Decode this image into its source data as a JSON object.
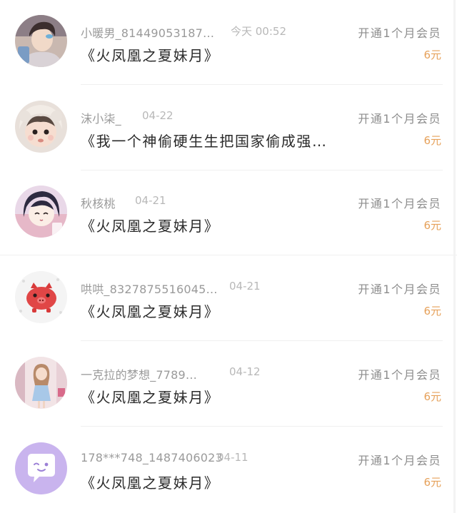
{
  "colors": {
    "name": "#9a9a9a",
    "time": "#b8b8b8",
    "title": "#2a2a2a",
    "action": "#8c8c8c",
    "price": "#e6a15a"
  },
  "rows": [
    {
      "avatar": "boy-photo-avatar",
      "name": "小暖男_81449053187…",
      "time": "今天 00:52",
      "title": "《火凤凰之夏妹月》",
      "action": "开通1个月会员",
      "price": "6元"
    },
    {
      "avatar": "baby-photo-avatar",
      "name": "沫小柒_",
      "time": "04-22",
      "title": "《我一个神偷硬生生把国家偷成强…",
      "action": "开通1个月会员",
      "price": "6元"
    },
    {
      "avatar": "anime-girl-avatar",
      "name": "秋核桃",
      "time": "04-21",
      "title": "《火凤凰之夏妹月》",
      "action": "开通1个月会员",
      "price": "6元"
    },
    {
      "avatar": "red-pig-avatar",
      "name": "哄哄_8327875516045…",
      "time": "04-21",
      "title": "《火凤凰之夏妹月》",
      "action": "开通1个月会员",
      "price": "6元"
    },
    {
      "avatar": "doll-girl-avatar",
      "name": "一克拉的梦想_7789…",
      "time": "04-12",
      "title": "《火凤凰之夏妹月》",
      "action": "开通1个月会员",
      "price": "6元"
    },
    {
      "avatar": "chat-bubble-avatar",
      "name": "178***748_1487406023",
      "time": "04-11",
      "title": "《火凤凰之夏妹月》",
      "action": "开通1个月会员",
      "price": "6元"
    }
  ]
}
